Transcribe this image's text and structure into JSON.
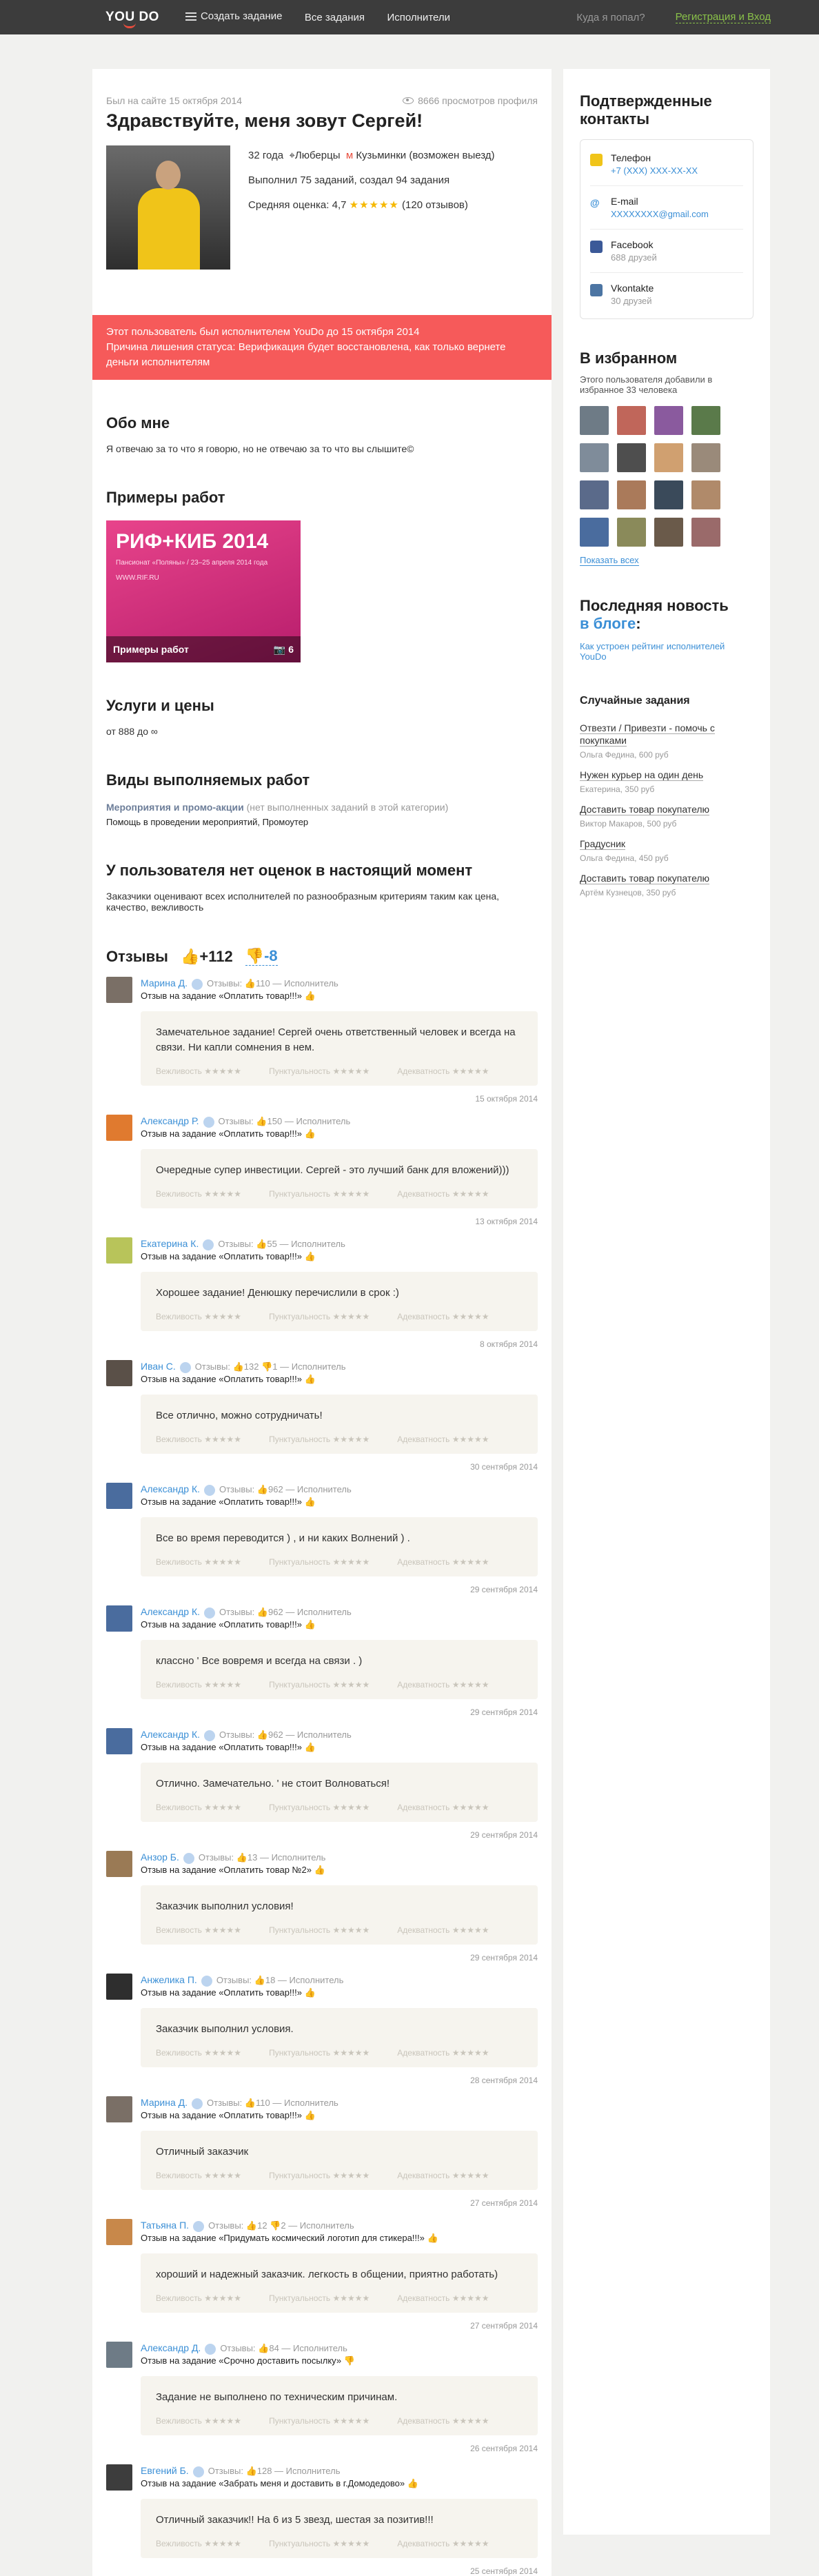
{
  "header": {
    "logo": "YOU DO",
    "create_task": "Создать задание",
    "all_tasks": "Все задания",
    "performers": "Исполнители",
    "where_placeholder": "Куда я попал?",
    "register_login": "Регистрация и Вход"
  },
  "profile": {
    "last_seen": "Был на сайте 15 октября 2014",
    "views": "8666 просмотров профиля",
    "greeting": "Здравствуйте, меня зовут Сергей!",
    "age": "32 года",
    "city": "Люберцы",
    "metro": "Кузьминки (возможен выезд)",
    "stats": "Выполнил 75 заданий, создал 94 задания",
    "rating_label": "Средняя оценка: 4,7",
    "rating_stars": "★★★★★",
    "reviews_count": "(120 отзывов)",
    "rating_value": 4.7
  },
  "alert": {
    "line1": "Этот пользователь был исполнителем YouDo до 15 октября 2014",
    "line2": "Причина лишения статуса: Верификация будет восстановлена, как только вернете деньги исполнителям"
  },
  "about": {
    "title": "Обо мне",
    "text": "Я отвечаю за то что я говорю, но не отвечаю за то что вы слышите©"
  },
  "works": {
    "title": "Примеры работ",
    "image_big": "РИФ+КИБ 2014",
    "image_sub": "Пансионат «Поляны» / 23–25 апреля 2014 года",
    "image_url": "WWW.RIF.RU",
    "caption": "Примеры работ",
    "photo_count": "6"
  },
  "services": {
    "title": "Услуги и цены",
    "price": "от 888 до ∞"
  },
  "categories": {
    "title": "Виды выполняемых работ",
    "cat1": "Мероприятия и промо-акции",
    "cat1_note": "(нет выполненных заданий в этой категории)",
    "sub": "Помощь в проведении мероприятий, Промоутер"
  },
  "no_ratings": {
    "title": "У пользователя нет оценок в настоящий момент",
    "text": "Заказчики оценивают всех исполнителей по разнообразным критериям таким как цена, качество, вежливость"
  },
  "reviews_summary": {
    "title": "Отзывы",
    "positive": "+112",
    "negative": "-8"
  },
  "criteria": {
    "c1": "Вежливость ★★★★★",
    "c2": "Пунктуальность ★★★★★",
    "c3": "Адекватность ★★★★★"
  },
  "reviews": [
    {
      "name": "Марина Д.",
      "counts": "Отзывы: 👍110 — Исполнитель",
      "task": "Отзыв на задание «Оплатить товар!!!» 👍",
      "text": "Замечательное задание! Сергей очень ответственный человек и всегда на связи. Ни капли сомнения в нем.",
      "date": "15 октября 2014",
      "color": "#7a6f66"
    },
    {
      "name": "Александр Р.",
      "counts": "Отзывы: 👍150 — Исполнитель",
      "task": "Отзыв на задание «Оплатить товар!!!» 👍",
      "text": "Очередные супер инвестиции. Сергей - это лучший банк для вложений)))",
      "date": "13 октября 2014",
      "color": "#e07a2f"
    },
    {
      "name": "Екатерина К.",
      "counts": "Отзывы: 👍55 — Исполнитель",
      "task": "Отзыв на задание «Оплатить товар!!!» 👍",
      "text": "Хорошее задание! Денюшку перечислили в срок :)",
      "date": "8 октября 2014",
      "color": "#b8c45a"
    },
    {
      "name": "Иван С.",
      "counts": "Отзывы: 👍132 👎1 — Исполнитель",
      "task": "Отзыв на задание «Оплатить товар!!!» 👍",
      "text": "Все отлично, можно сотрудничать!",
      "date": "30 сентября 2014",
      "color": "#5a5048"
    },
    {
      "name": "Александр К.",
      "counts": "Отзывы: 👍962 — Исполнитель",
      "task": "Отзыв на задание «Оплатить товар!!!» 👍",
      "text": "Все во время переводится ) , и ни каких Волнений ) .",
      "date": "29 сентября 2014",
      "color": "#4a6c9e"
    },
    {
      "name": "Александр К.",
      "counts": "Отзывы: 👍962 — Исполнитель",
      "task": "Отзыв на задание «Оплатить товар!!!» 👍",
      "text": "классно ' Все вовремя и всегда на связи . )",
      "date": "29 сентября 2014",
      "color": "#4a6c9e"
    },
    {
      "name": "Александр К.",
      "counts": "Отзывы: 👍962 — Исполнитель",
      "task": "Отзыв на задание «Оплатить товар!!!» 👍",
      "text": "Отлично. Замечательно. ' не стоит Волноваться!",
      "date": "29 сентября 2014",
      "color": "#4a6c9e"
    },
    {
      "name": "Анзор Б.",
      "counts": "Отзывы: 👍13 — Исполнитель",
      "task": "Отзыв на задание «Оплатить товар №2» 👍",
      "text": "Заказчик выполнил условия!",
      "date": "29 сентября 2014",
      "color": "#9a7a55"
    },
    {
      "name": "Анжелика П.",
      "counts": "Отзывы: 👍18 — Исполнитель",
      "task": "Отзыв на задание «Оплатить товар!!!» 👍",
      "text": "Заказчик выполнил условия.",
      "date": "28 сентября 2014",
      "color": "#2e2e2e"
    },
    {
      "name": "Марина Д.",
      "counts": "Отзывы: 👍110 — Исполнитель",
      "task": "Отзыв на задание «Оплатить товар!!!» 👍",
      "text": "Отличный заказчик",
      "date": "27 сентября 2014",
      "color": "#7a6f66"
    },
    {
      "name": "Татьяна П.",
      "counts": "Отзывы: 👍12 👎2 — Исполнитель",
      "task": "Отзыв на задание «Придумать космический логотип для стикера!!!» 👍",
      "text": "хороший и надежный заказчик. легкость в общении, приятно работать)",
      "date": "27 сентября 2014",
      "color": "#c8884a"
    },
    {
      "name": "Александр Д.",
      "counts": "Отзывы: 👍84 — Исполнитель",
      "task": "Отзыв на задание «Срочно доставить посылку» 👎",
      "text": "Задание не выполнено по техническим причинам.",
      "date": "26 сентября 2014",
      "color": "#6e7b86"
    },
    {
      "name": "Евгений Б.",
      "counts": "Отзывы: 👍128 — Исполнитель",
      "task": "Отзыв на задание «Забрать меня и доставить в г.Домодедово» 👍",
      "text": "Отличный заказчик!! На 6 из 5 звезд, шестая за позитив!!!",
      "date": "25 сентября 2014",
      "color": "#3d3d3d"
    }
  ],
  "sidebar": {
    "contacts_title": "Подтвержденные контакты",
    "phone_label": "Телефон",
    "phone_value": "+7 (XXX) XXX-XX-XX",
    "email_label": "E-mail",
    "email_value": "XXXXXXXX@gmail.com",
    "fb_label": "Facebook",
    "fb_value": "688 друзей",
    "vk_label": "Vkontakte",
    "vk_value": "30 друзей",
    "fav_title": "В избранном",
    "fav_text": "Этого пользователя добавили в избранное 33 человека",
    "show_all": "Показать всех",
    "news_title": "Последняя новость",
    "news_blog": "в блоге",
    "news_link": "Как устроен рейтинг исполнителей YouDo",
    "random_title": "Случайные задания",
    "tasks": [
      {
        "t": "Отвезти / Привезти - помочь с покупками",
        "s": "Ольга Федина, 600 руб"
      },
      {
        "t": "Нужен курьер на один день",
        "s": "Екатерина, 350 руб"
      },
      {
        "t": "Доставить товар покупателю",
        "s": "Виктор Макаров, 500 руб"
      },
      {
        "t": "Градусник",
        "s": "Ольга Федина, 450 руб"
      },
      {
        "t": "Доставить товар покупателю",
        "s": "Артём Кузнецов, 350 руб"
      }
    ]
  }
}
